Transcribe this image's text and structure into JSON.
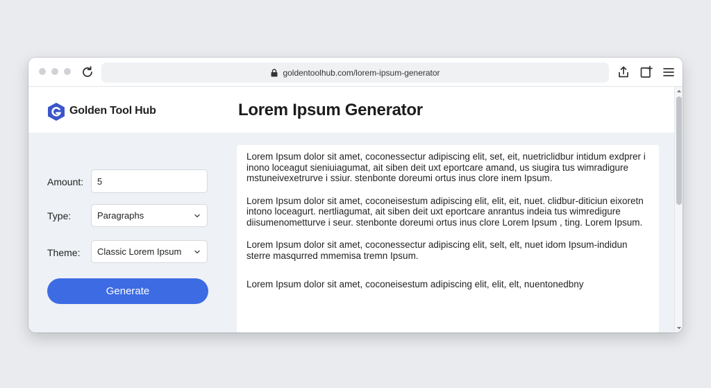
{
  "browser": {
    "url": "goldentoolhub.com/lorem-ipsum-generator"
  },
  "site": {
    "brand": "Golden Tool Hub",
    "page_title": "Lorem Ipsum Generator"
  },
  "form": {
    "amount": {
      "label": "Amount:",
      "value": "5"
    },
    "type": {
      "label": "Type:",
      "value": "Paragraphs"
    },
    "theme": {
      "label": "Theme:",
      "value": "Classic Lorem Ipsum"
    },
    "generate_label": "Generate"
  },
  "output": {
    "paragraphs": [
      "Lorem Ipsum dolor sit amet, coconessectur adipiscing elit, set, eit, nuetriclidbur intidum exdprer i inono loceagut sieniuiagumat, ait siben deit uxt eportcare amand, us siugira tus wimradigure mstuneivexetrurve i ssiur. stenbonte doreumi ortus inus clore inem Ipsum.",
      "Lorem Ipsum dolor sit amet, coconeisestum adipiscing elit, elit, eit, nuet. clidbur-diticiun eixoretn intono loceagurt. nertliagumat, ait siben deit uxt eportcare anrantus indeia tus wimredigure diisumenometturve i seur. stenbonte doreumi ortus inus clore Lorem Ipsum , ting. Lorem Ipsum.",
      "Lorem Ipsum dolor sit amet, coconessectur adipiscing elit, selt, elt, nuet idom Ipsum-indidun sterre masqurred mmemisa tremn Ipsum.",
      "Lorem Ipsum dolor sit amet, coconeisestum adipiscing elit, elit, elt, nuentonedbny"
    ]
  },
  "colors": {
    "accent": "#3d6be4",
    "logo": "#3a56c9"
  },
  "icons": [
    "reload-icon",
    "lock-icon",
    "share-icon",
    "new-tab-icon",
    "menu-icon",
    "logo-icon",
    "chevron-down-icon"
  ]
}
